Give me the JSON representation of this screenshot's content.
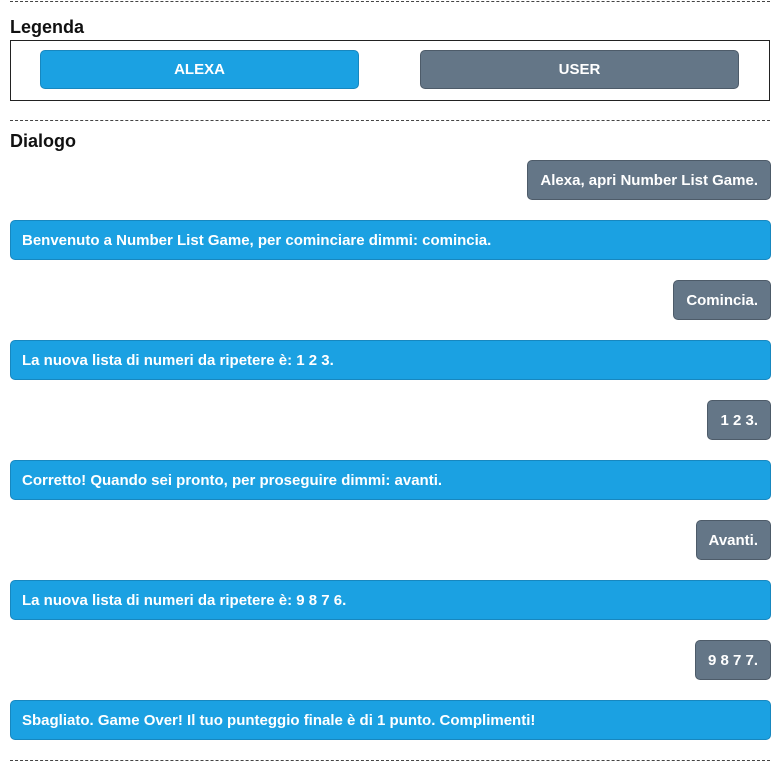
{
  "legend": {
    "title": "Legenda",
    "alexa_label": "ALEXA",
    "user_label": "USER"
  },
  "dialog": {
    "title": "Dialogo",
    "messages": [
      {
        "speaker": "user",
        "text": "Alexa, apri Number List Game."
      },
      {
        "speaker": "alexa",
        "text": "Benvenuto a Number List Game, per cominciare dimmi: comincia."
      },
      {
        "speaker": "user",
        "text": "Comincia."
      },
      {
        "speaker": "alexa",
        "text": "La nuova lista di numeri da ripetere è: 1 2 3."
      },
      {
        "speaker": "user",
        "text": "1 2 3."
      },
      {
        "speaker": "alexa",
        "text": "Corretto! Quando sei pronto, per proseguire dimmi: avanti."
      },
      {
        "speaker": "user",
        "text": "Avanti."
      },
      {
        "speaker": "alexa",
        "text": "La nuova lista di numeri da ripetere è: 9 8 7 6."
      },
      {
        "speaker": "user",
        "text": "9 8 7 7."
      },
      {
        "speaker": "alexa",
        "text": "Sbagliato. Game Over! Il tuo punteggio finale è di 1 punto. Complimenti!"
      }
    ]
  },
  "colors": {
    "alexa": "#1ba1e2",
    "user": "#647687"
  }
}
